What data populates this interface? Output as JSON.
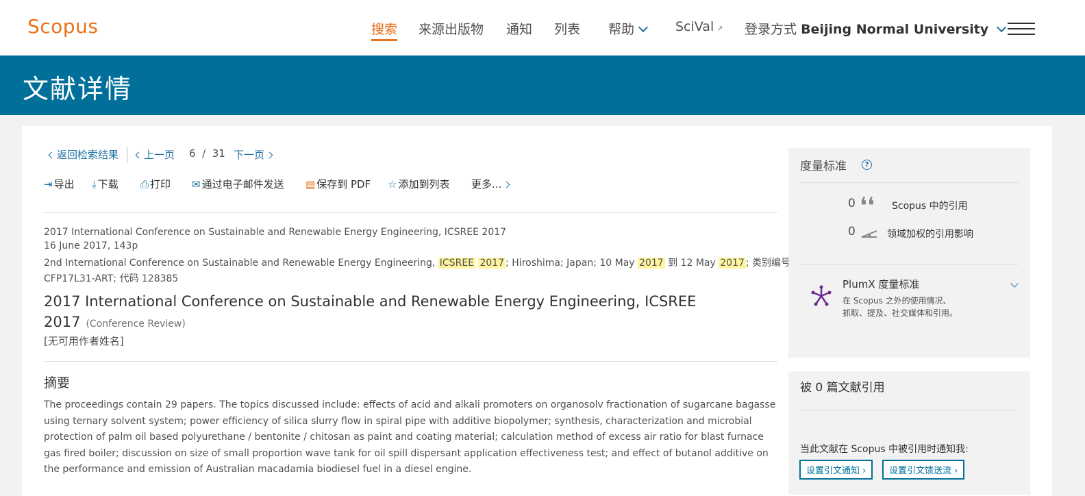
{
  "header": {
    "logo": "Scopus",
    "nav": {
      "search": "搜索",
      "sources": "来源出版物",
      "alerts": "通知",
      "lists": "列表",
      "help": "帮助",
      "scival": "SciVal",
      "login_prefix": "登录方式",
      "institution": "Beijing Normal University"
    }
  },
  "banner": {
    "title": "文献详情"
  },
  "pager": {
    "back": "返回检索结果",
    "prev": "上一页",
    "current": "6",
    "slash": "/",
    "total": "31",
    "next": "下一页"
  },
  "actions": {
    "export": "导出",
    "download": "下载",
    "print": "打印",
    "email": "通过电子邮件发送",
    "pdf": "保存到 PDF",
    "add_list": "添加到列表",
    "more": "更多..."
  },
  "document": {
    "source_line": "2017 International Conference on Sustainable and Renewable Energy Engineering, ICSREE 2017",
    "date_pages": "16 June 2017, 143p",
    "conf_a": "2nd International Conference on Sustainable and Renewable Energy Engineering, ",
    "hl1": "ICSREE",
    "hl2": "2017",
    "conf_b": "; Hiroshima; Japan; 10 May ",
    "hl3": "2017",
    "conf_c": " 到 12 May ",
    "hl4": "2017",
    "conf_d": "; 类别编号",
    "conf_line2": "CFP17L31-ART; 代码 128385",
    "title": "2017 International Conference on Sustainable and Renewable Energy Engineering, ICSREE 2017",
    "doc_type": "(Conference Review)",
    "authors": "[无可用作者姓名]",
    "abstract_heading": "摘要",
    "abstract": "The proceedings contain 29 papers. The topics discussed include: effects of acid and alkali promoters on organosolv fractionation of sugarcane bagasse using ternary solvent system; power efficiency of silica slurry flow in spiral pipe with additive biopolymer; synthesis, characterization and microbial protection of palm oil based polyurethane / bentonite / chitosan as paint and coating material; calculation method of excess air ratio for blast furnace gas fired boiler; discussion on size of small proportion wave tank for oil spill dispersant application effectiveness test; and effect of butanol additive on the performance and emission of Australian macadamia biodiesel fuel in a diesel engine."
  },
  "metrics": {
    "heading": "度量标准",
    "help_icon": "?",
    "citations_count": "0",
    "citations_label": "Scopus 中的引用",
    "fwci_count": "0",
    "fwci_label": "领域加权的引用影响",
    "plumx_title": "PlumX 度量标准",
    "plumx_desc": "在 Scopus 之外的使用情况、抓取、提及、社交媒体和引用。"
  },
  "cited_by": {
    "heading": "被 0 篇文献引用",
    "notify_text": "当此文献在 Scopus 中被引用时通知我:",
    "set_alert": "设置引文通知",
    "set_feed": "设置引文馈送流"
  },
  "icons": {
    "nav_chevron": "chevron-down-icon",
    "external": "external-link-icon",
    "menu": "hamburger-menu-icon",
    "quote": "quote-icon",
    "fwci": "fwci-icon",
    "plumx": "plumx-icon"
  },
  "colors": {
    "brand": "#e9711c",
    "banner": "#00709b",
    "link": "#1e71a3",
    "highlight": "#fff5a0"
  }
}
